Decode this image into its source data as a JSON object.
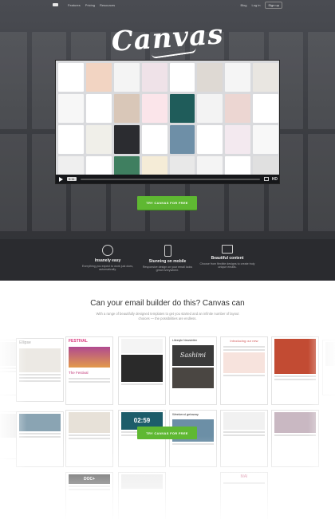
{
  "nav": {
    "left": [
      "Features",
      "Pricing",
      "Resources"
    ],
    "right_blog": "Blog",
    "right_login": "Log in",
    "right_signup": "Sign up"
  },
  "hero": {
    "brand": "Canvas",
    "video_time": "0:11",
    "video_hd": "HD",
    "video_progress_percent": 0,
    "cta": "TRY CANVAS FOR FREE"
  },
  "features": [
    {
      "icon": "compass-icon",
      "title": "Insanely easy",
      "text": "Everything you expect to work just does, automatically."
    },
    {
      "icon": "mobile-icon",
      "title": "Stunning on mobile",
      "text": "Responsive design on your email looks great everywhere."
    },
    {
      "icon": "image-icon",
      "title": "Beautiful content",
      "text": "Choose from flexible designs to create truly unique emails."
    }
  ],
  "section2": {
    "title": "Can your email builder do this? Canvas can",
    "subtitle": "With a range of beautifully designed templates to get you started and an infinite number of layout choices — the possibilities are endless.",
    "cta": "TRY CANVAS FOR FREE"
  },
  "tile_texts": {
    "festival": "FESTIVAL",
    "the_festival": "The Festival",
    "lifestyle": "Lifestyle Newsletter",
    "sashimi": "Sashimi",
    "clock": "02:59",
    "weekend": "Weekend getaway",
    "doc": "DOC+",
    "mai": "MAI"
  },
  "colors": {
    "accent_green": "#5fb832",
    "hero_dark": "#2f3034"
  }
}
